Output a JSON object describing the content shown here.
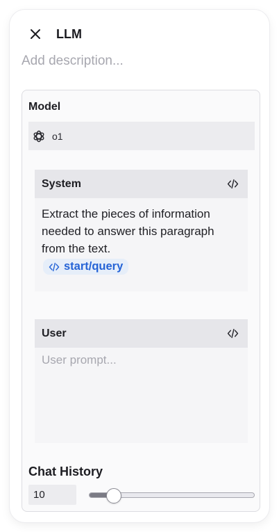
{
  "node": {
    "title": "LLM",
    "description_placeholder": "Add description..."
  },
  "model": {
    "label": "Model",
    "selected": "o1",
    "icon": "openai-logo-icon"
  },
  "system": {
    "title": "System",
    "text": "Extract the pieces of information needed to answer this paragraph from the text.",
    "variable": "start/query",
    "toggle_icon": "code-icon"
  },
  "user": {
    "title": "User",
    "placeholder": "User prompt...",
    "toggle_icon": "code-icon"
  },
  "chat_history": {
    "label": "Chat History",
    "value": "10",
    "slider_fraction": 0.1
  },
  "colors": {
    "accent": "#2563d6",
    "chip_bg": "#e6eef9",
    "panel_bg": "#fafafb"
  }
}
